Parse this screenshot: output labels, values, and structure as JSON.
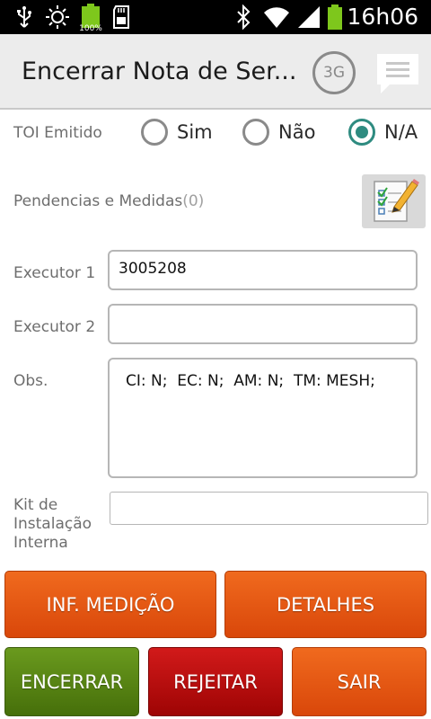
{
  "status_bar": {
    "time": "16h06",
    "battery_small_label": "100%",
    "icons": [
      "usb-icon",
      "brightness-icon",
      "battery-full-icon",
      "sd-card-icon",
      "bluetooth-icon",
      "wifi-icon",
      "signal-icon",
      "battery-icon"
    ]
  },
  "action_bar": {
    "title": "Encerrar Nota de Ser...",
    "network_badge": "3G",
    "message_icon": "message-icon"
  },
  "form": {
    "toi_label": "TOI Emitido",
    "toi_options": [
      {
        "label": "Sim",
        "selected": false
      },
      {
        "label": "Não",
        "selected": false
      },
      {
        "label": "N/A",
        "selected": true
      }
    ],
    "pendencias_label": "Pendencias e Medidas",
    "pendencias_count": "(0)",
    "executor1_label": "Executor 1",
    "executor1_value": "3005208",
    "executor2_label": "Executor 2",
    "executor2_value": "",
    "obs_label": "Obs.",
    "obs_value": "CI: N;  EC: N;  AM: N;  TM: MESH;",
    "kit_label": "Kit de\nInstalação\nInterna",
    "kit_value": ""
  },
  "buttons": {
    "inf_medicao": "INF. MEDIÇÃO",
    "detalhes": "DETALHES",
    "encerrar": "ENCERRAR",
    "rejeitar": "REJEITAR",
    "sair": "SAIR"
  },
  "colors": {
    "accent_radio": "#2e8b80",
    "orange": "#e8561a",
    "green": "#557f13",
    "red": "#c00808"
  }
}
